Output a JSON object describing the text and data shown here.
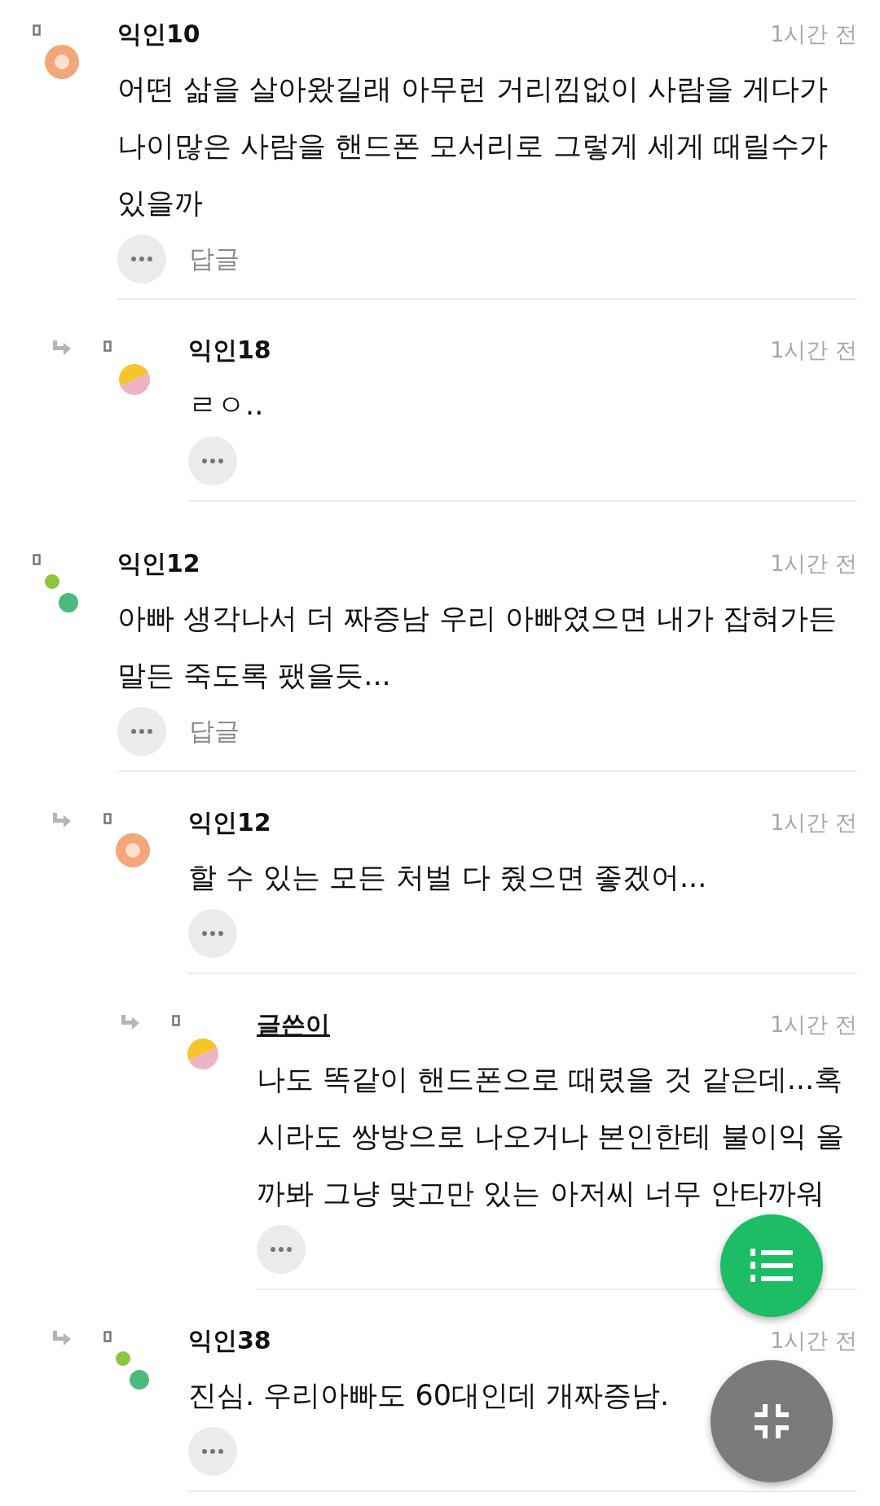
{
  "comments": [
    {
      "author": "익인10",
      "is_writer": false,
      "avatar": {
        "kind": "ring"
      },
      "time": "1시간 전",
      "body": "어떤 삶을 살아왔길래 아무런 거리낌없이 사람을 게다가 나이많은 사람을 핸드폰 모서리로 그렇게 세게 때릴수가 있을까",
      "reply_label": "답글",
      "children": [
        {
          "author": "익인18",
          "is_writer": false,
          "avatar": {
            "kind": "halves"
          },
          "time": "1시간 전",
          "body": "ㄹㅇ.."
        }
      ]
    },
    {
      "author": "익인12",
      "is_writer": false,
      "avatar": {
        "kind": "dots"
      },
      "time": "1시간 전",
      "body": "아빠 생각나서 더 짜증남 우리 아빠였으면 내가 잡혀가든 말든 죽도록 팼을듯...",
      "reply_label": "답글",
      "children": [
        {
          "author": "익인12",
          "is_writer": false,
          "avatar": {
            "kind": "ring"
          },
          "time": "1시간 전",
          "body": "할 수 있는 모든 처벌 다 줬으면 좋겠어...",
          "children": [
            {
              "author": "글쓴이",
              "is_writer": true,
              "avatar": {
                "kind": "halves"
              },
              "time": "1시간 전",
              "body": "나도 똑같이 핸드폰으로 때렸을 것 같은데...혹시라도 쌍방으로 나오거나 본인한테 불이익 올까봐 그냥 맞고만 있는 아저씨 너무 안타까워"
            }
          ]
        },
        {
          "author": "익인38",
          "is_writer": false,
          "avatar": {
            "kind": "dots"
          },
          "time": "1시간 전",
          "body": "진심. 우리아빠도 60대인데 개짜증남."
        }
      ]
    }
  ]
}
